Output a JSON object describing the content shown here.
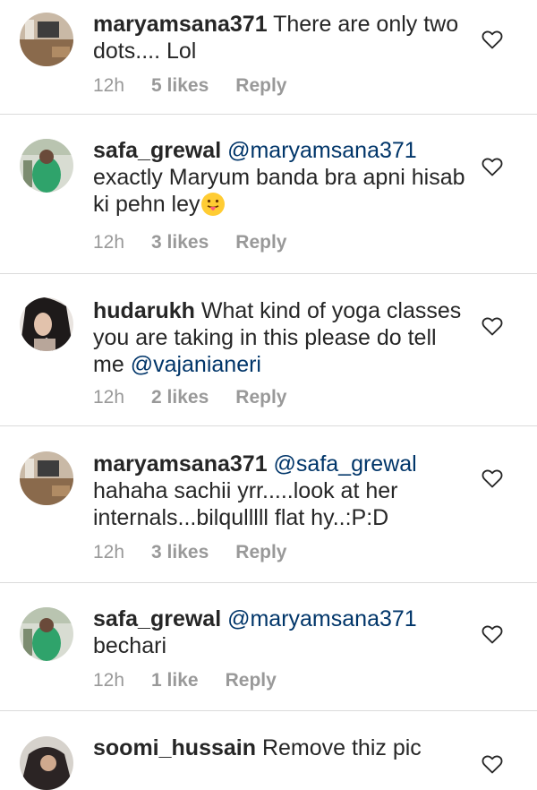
{
  "comments": [
    {
      "username": "maryamsana371",
      "mention": "",
      "text": "There are only two dots.... Lol",
      "time": "12h",
      "likes": "5 likes",
      "reply": "Reply",
      "avatar": "room-photo"
    },
    {
      "username": "safa_grewal",
      "mention": "@maryamsana371",
      "text": "exactly Maryum banda bra apni hisab ki pehn ley",
      "emoji": "tongue-out-emoji",
      "time": "12h",
      "likes": "3 likes",
      "reply": "Reply",
      "avatar": "green-dress-photo"
    },
    {
      "username": "hudarukh",
      "mention": "",
      "text": "What kind of yoga classes you are taking in this please do tell me",
      "mention_after": "@vajanianeri",
      "time": "12h",
      "likes": "2 likes",
      "reply": "Reply",
      "avatar": "selfie-photo"
    },
    {
      "username": "maryamsana371",
      "mention": "@safa_grewal",
      "text": "hahaha sachii yrr.....look at her internals...bilqulllll flat hy..:P:D",
      "time": "12h",
      "likes": "3 likes",
      "reply": "Reply",
      "avatar": "room-photo"
    },
    {
      "username": "safa_grewal",
      "mention": "@maryamsana371",
      "text": "bechari",
      "time": "12h",
      "likes": "1 like",
      "reply": "Reply",
      "avatar": "green-dress-photo"
    },
    {
      "username": "soomi_hussain",
      "mention": "",
      "text": "Remove thiz pic",
      "avatar": "dark-photo"
    }
  ]
}
